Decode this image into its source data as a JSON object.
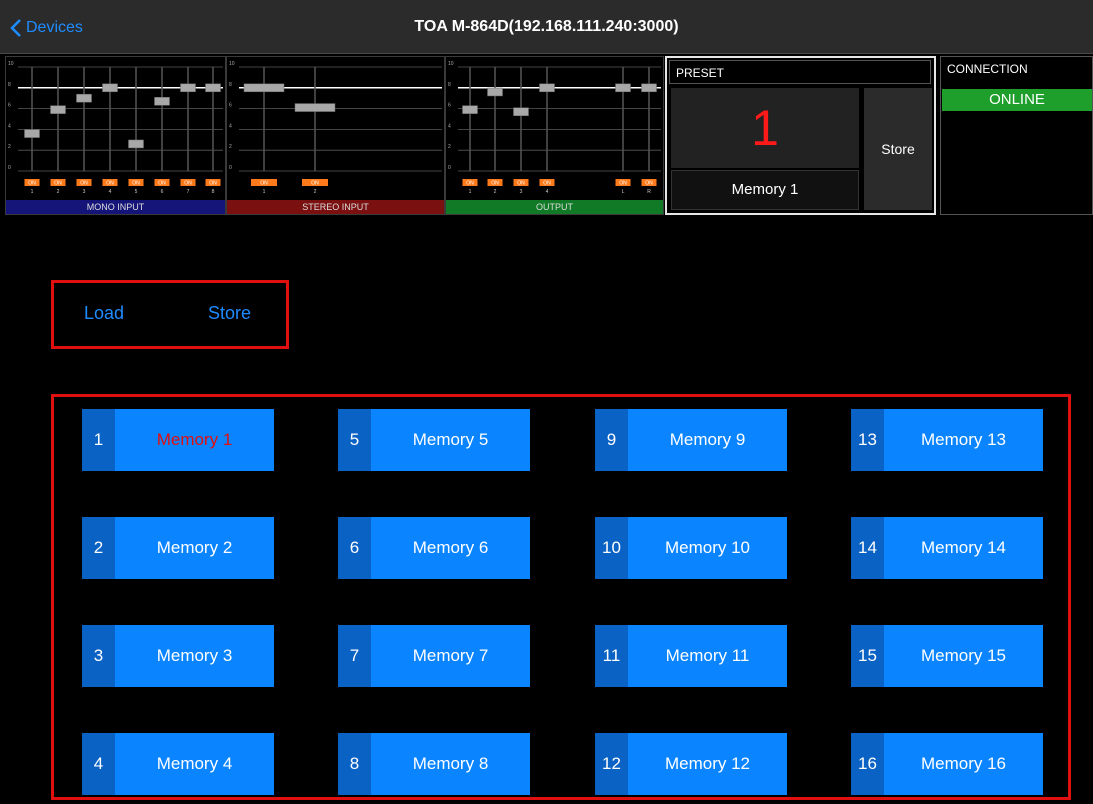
{
  "nav": {
    "back_label": "Devices",
    "title": "TOA M-864D(192.168.111.240:3000)"
  },
  "mixers": {
    "mono": {
      "label": "MONO INPUT",
      "scale": [
        "10",
        "8",
        "6",
        "4",
        "2",
        "0"
      ],
      "channels": [
        "1",
        "2",
        "3",
        "4",
        "5",
        "6",
        "7",
        "8"
      ],
      "on_label": "ON",
      "levels": [
        3.6,
        5.9,
        7.0,
        8.0,
        2.6,
        6.7,
        8.0,
        8.0
      ]
    },
    "stereo": {
      "label": "STEREO INPUT",
      "scale": [
        "10",
        "8",
        "6",
        "4",
        "2",
        "0"
      ],
      "channels": [
        "1",
        "2"
      ],
      "on_label": "ON",
      "levels": [
        8.0,
        6.1
      ]
    },
    "output": {
      "label": "OUTPUT",
      "scale": [
        "10",
        "8",
        "6",
        "4",
        "2",
        "0"
      ],
      "channels": [
        "1",
        "2",
        "3",
        "4",
        "L",
        "R"
      ],
      "on_label": "ON",
      "levels": [
        5.9,
        7.6,
        5.7,
        8.0,
        8.0,
        8.0
      ]
    }
  },
  "preset": {
    "header": "PRESET",
    "number": "1",
    "name": "Memory 1",
    "store_label": "Store"
  },
  "connection": {
    "header": "CONNECTION",
    "status": "ONLINE"
  },
  "mode": {
    "load_label": "Load",
    "store_label": "Store"
  },
  "memories": [
    {
      "num": "1",
      "name": "Memory 1",
      "active": true
    },
    {
      "num": "2",
      "name": "Memory 2"
    },
    {
      "num": "3",
      "name": "Memory 3"
    },
    {
      "num": "4",
      "name": "Memory 4"
    },
    {
      "num": "5",
      "name": "Memory 5"
    },
    {
      "num": "6",
      "name": "Memory 6"
    },
    {
      "num": "7",
      "name": "Memory 7"
    },
    {
      "num": "8",
      "name": "Memory 8"
    },
    {
      "num": "9",
      "name": "Memory 9"
    },
    {
      "num": "10",
      "name": "Memory 10"
    },
    {
      "num": "11",
      "name": "Memory 11"
    },
    {
      "num": "12",
      "name": "Memory 12"
    },
    {
      "num": "13",
      "name": "Memory 13"
    },
    {
      "num": "14",
      "name": "Memory 14"
    },
    {
      "num": "15",
      "name": "Memory 15"
    },
    {
      "num": "16",
      "name": "Memory 16"
    }
  ],
  "colors": {
    "accent": "#1e8cff",
    "memory_button": "#0a84ff",
    "highlight_border": "#e01010",
    "online": "#1e9e2a",
    "on_badge": "#ff7a1a"
  }
}
